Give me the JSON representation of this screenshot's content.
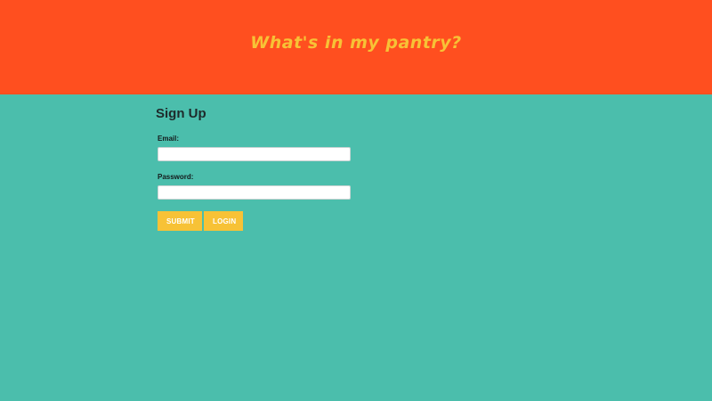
{
  "header": {
    "title": "What's in my pantry?",
    "background_color": "#ff4f1f",
    "title_color": "#f7c236"
  },
  "form": {
    "heading": "Sign Up",
    "email_label": "Email:",
    "email_value": "",
    "password_label": "Password:",
    "password_value": "",
    "submit_label": "SUBMIT",
    "login_label": "LOGIN",
    "button_color": "#f7c236"
  },
  "page": {
    "background_color": "#4bbeac"
  }
}
